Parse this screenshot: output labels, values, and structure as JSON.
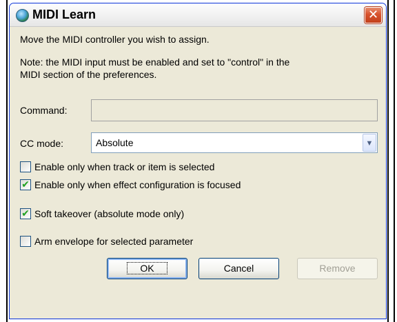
{
  "window": {
    "title": "MIDI Learn",
    "close_label": "✕"
  },
  "instructions": {
    "line1": "Move the MIDI controller you wish to assign.",
    "note_line1": "Note: the MIDI input must be enabled and set to \"control\" in the",
    "note_line2": "MIDI section of the preferences."
  },
  "command": {
    "label": "Command:",
    "value": ""
  },
  "cc_mode": {
    "label": "CC mode:",
    "selected": "Absolute"
  },
  "options": [
    {
      "label": "Enable only when track or item is selected",
      "checked": false
    },
    {
      "label": "Enable only when effect configuration is focused",
      "checked": true
    },
    {
      "label": "Soft takeover (absolute mode only)",
      "checked": true
    },
    {
      "label": "Arm envelope for selected parameter",
      "checked": false
    }
  ],
  "buttons": {
    "ok": "OK",
    "cancel": "Cancel",
    "remove": "Remove"
  },
  "colors": {
    "titlebar_border": "#0831d9",
    "close_button": "#d8522d",
    "dialog_bg": "#ece9d8",
    "check_mark": "#21a121"
  }
}
